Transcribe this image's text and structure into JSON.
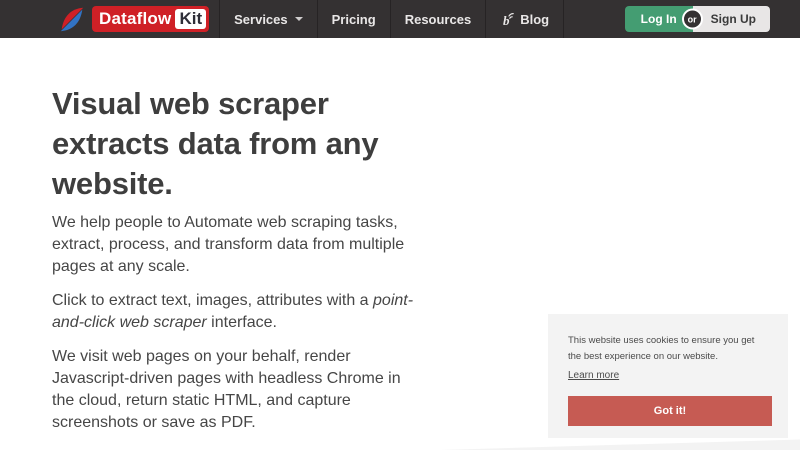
{
  "navbar": {
    "brand": {
      "icon": "dataflow-logo-icon",
      "primary": "Dataflow",
      "secondary": "Kit"
    },
    "items": [
      {
        "label": "Services",
        "has_dropdown": true
      },
      {
        "label": "Pricing"
      },
      {
        "label": "Resources"
      },
      {
        "label": "Blog",
        "icon": "blog-icon"
      }
    ],
    "auth": {
      "login": "Log In",
      "divider": "or",
      "signup": "Sign Up"
    }
  },
  "hero": {
    "heading_lines": [
      "Visual web scraper",
      "extracts data from any",
      "website."
    ],
    "p1_lines": [
      "We help people to Automate web scraping tasks,",
      "extract, process, and transform data from multiple",
      "pages at any scale."
    ],
    "p2": {
      "line1_normal": "Click to extract text, images, attributes with a ",
      "line1_italic": "point-",
      "line2_italic": "and-click web scraper",
      "line2_normal": " interface."
    },
    "p3_lines": [
      "We visit web pages on your behalf, render",
      "Javascript-driven pages with headless Chrome in",
      "the cloud, return static HTML, and capture",
      "screenshots or save as PDF."
    ]
  },
  "cookie_banner": {
    "message_lines": [
      "This website uses cookies to ensure you get",
      "the best experience on our website."
    ],
    "learn_more": "Learn more",
    "accept": "Got it!"
  },
  "colors": {
    "navbar_bg": "#343132",
    "logo_red": "#cf2026",
    "logo_blue": "#3273c4",
    "login_green": "#449d72",
    "signup_gray": "#e8e6e6",
    "accept_red": "#c65b53",
    "cookie_bg": "#f3f3f3",
    "heading_text": "#3e3e3e",
    "body_text": "#464646"
  }
}
